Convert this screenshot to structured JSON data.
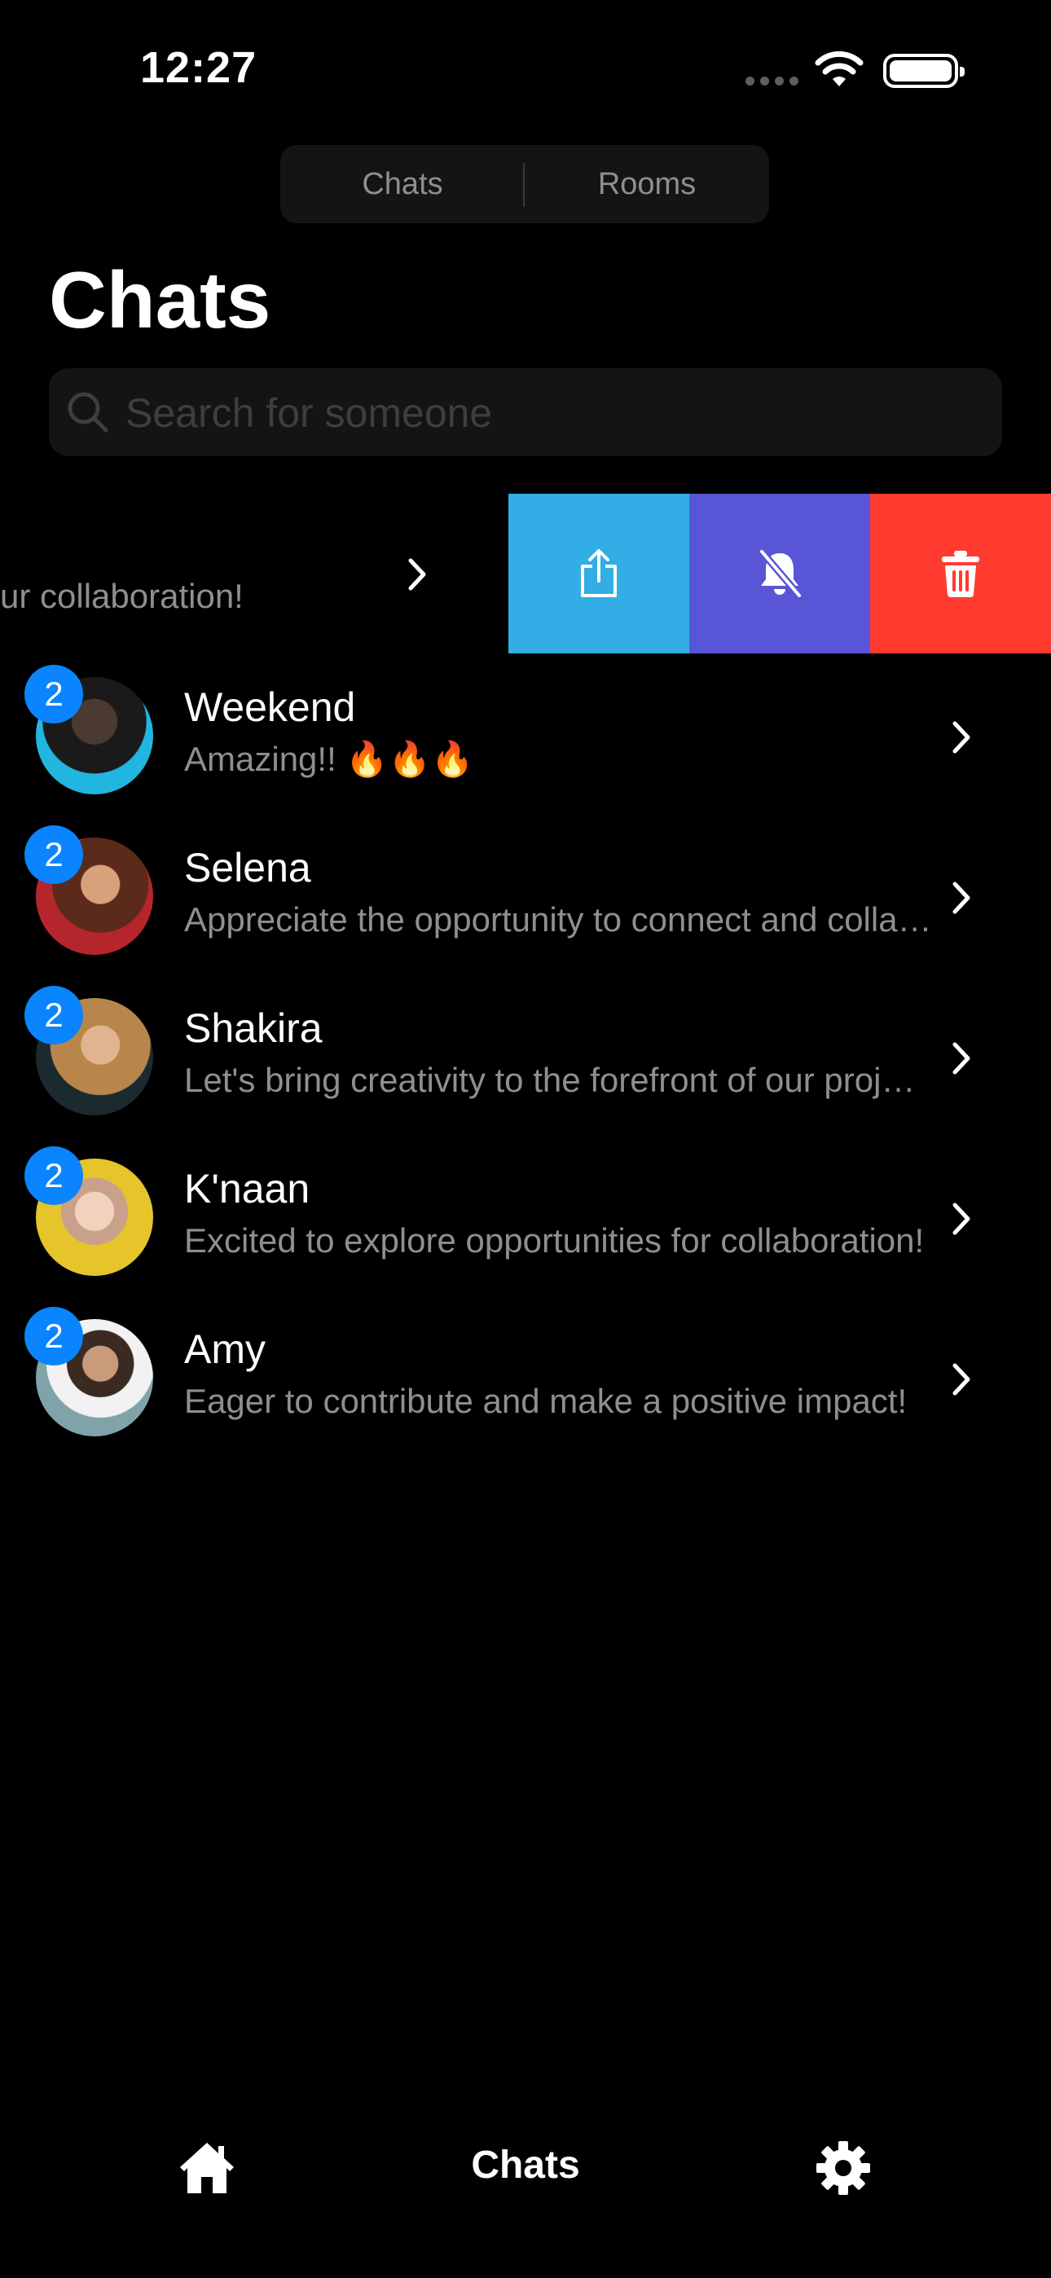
{
  "status_bar": {
    "time": "12:27"
  },
  "segmented_control": {
    "chats_label": "Chats",
    "rooms_label": "Rooms"
  },
  "page_title": "Chats",
  "search": {
    "placeholder": "Search for someone",
    "value": ""
  },
  "swiped_row": {
    "preview": "ur collaboration!",
    "actions": [
      {
        "name": "share",
        "icon": "share-icon",
        "color": "#32ade6"
      },
      {
        "name": "mute",
        "icon": "bell-slash-icon",
        "color": "#5856d6"
      },
      {
        "name": "delete",
        "icon": "trash-icon",
        "color": "#ff3b30"
      }
    ]
  },
  "chats": [
    {
      "name": "Weekend",
      "preview": "Amazing!! 🔥🔥🔥",
      "unread": "2"
    },
    {
      "name": "Selena",
      "preview": "Appreciate the opportunity to connect and collaborate!",
      "unread": "2"
    },
    {
      "name": "Shakira",
      "preview": "Let's bring creativity to the forefront of our projects!",
      "unread": "2"
    },
    {
      "name": "K'naan",
      "preview": "Excited to explore opportunities for collaboration!",
      "unread": "2"
    },
    {
      "name": "Amy",
      "preview": "Eager to contribute and make a positive impact!",
      "unread": "2"
    }
  ],
  "tab_bar": {
    "home_icon": "house-icon",
    "chats_label": "Chats",
    "settings_icon": "gear-icon"
  },
  "colors": {
    "accent": "#0a84ff",
    "background": "#000000",
    "secondary_text": "#8e8e93"
  }
}
